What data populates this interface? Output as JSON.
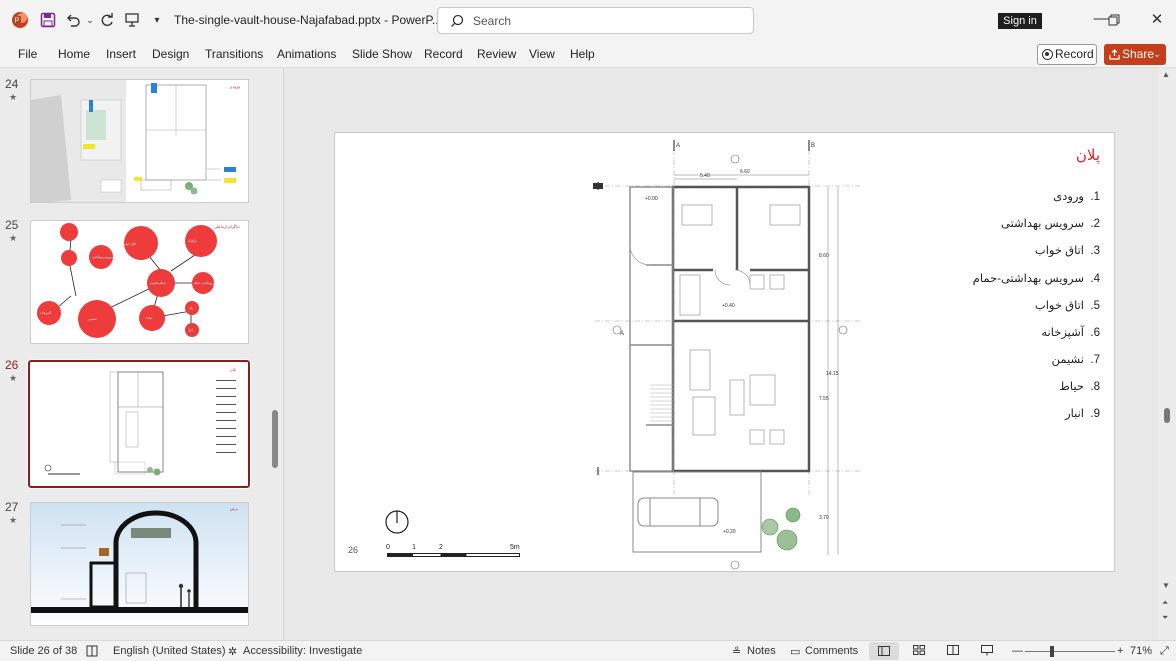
{
  "app": {
    "title": "The-single-vault-house-Najafabad.pptx  -  PowerP...",
    "search_placeholder": "Search",
    "signin_label": "Sign in"
  },
  "ribbon": {
    "tabs": [
      "File",
      "Home",
      "Insert",
      "Design",
      "Transitions",
      "Animations",
      "Slide Show",
      "Record",
      "Review",
      "View",
      "Help"
    ],
    "record_label": "Record",
    "share_label": "Share"
  },
  "thumbnails": [
    {
      "number": "24",
      "title": "ورودی"
    },
    {
      "number": "25",
      "title": "دیاگرام ارتباطی",
      "bubbles": [
        "اتاق خواب",
        "سرویس بهداشتی",
        "پارکینگ",
        "فضای تقسیم",
        "سرویس بهداشتی حمام",
        "آشپزخانه",
        "نشیمن",
        "حیاط",
        "پله",
        "انبار"
      ]
    },
    {
      "number": "26",
      "title": "پلان"
    },
    {
      "number": "27",
      "title": "برش"
    }
  ],
  "slide": {
    "title": "پلان",
    "page_number": "26",
    "legend": [
      {
        "n": "1.",
        "label": "ورودی"
      },
      {
        "n": "2.",
        "label": "سرویس بهداشتی"
      },
      {
        "n": "3.",
        "label": "اتاق خواب"
      },
      {
        "n": "4.",
        "label": "سرویس بهداشتی-حمام"
      },
      {
        "n": "5.",
        "label": "اتاق خواب"
      },
      {
        "n": "6.",
        "label": "آشپزخانه"
      },
      {
        "n": "7.",
        "label": "نشیمن"
      },
      {
        "n": "8.",
        "label": "حیاط"
      },
      {
        "n": "9.",
        "label": "انبار"
      }
    ],
    "plan": {
      "dims": [
        "5.40",
        "6.60",
        "8.60",
        "14.15",
        "7.55",
        "3.70"
      ],
      "levels": [
        "+0.00",
        "+0.40",
        "+0.20"
      ],
      "scale_labels": [
        "0",
        "1",
        "2",
        "5m"
      ],
      "section_marks": [
        "A",
        "B",
        "A"
      ]
    }
  },
  "status": {
    "slide_info": "Slide 26 of 38",
    "language": "English (United States)",
    "accessibility": "Accessibility: Investigate",
    "notes": "Notes",
    "comments": "Comments",
    "zoom": "71%"
  },
  "colors": {
    "accent": "#c43e1c",
    "slide_title_red": "#d9252a",
    "active_thumb_border": "#8b1c1c",
    "bubble_red": "#ee3b3b"
  }
}
